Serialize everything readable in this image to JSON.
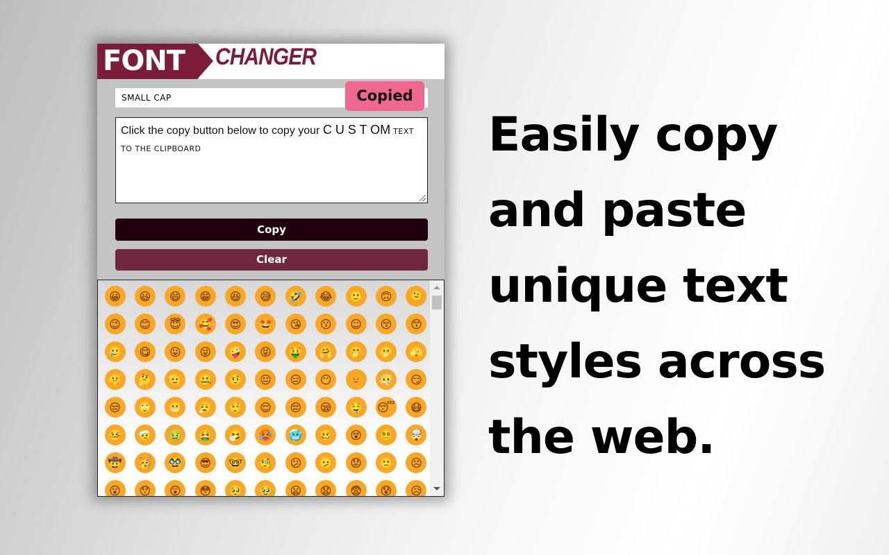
{
  "logo": {
    "part1": "FONT",
    "part2": "CHANGER",
    "brand_color": "#7a1c3a"
  },
  "style_input": {
    "value": "SMALL CAP"
  },
  "copied_badge": {
    "label": "Copied",
    "color": "#f06890"
  },
  "textarea": {
    "text_normal": "Click the copy button below to copy your ",
    "text_spaced": "C U S T OM",
    "text_smallcaps": " TEXT TO THE CLIPBOARD"
  },
  "buttons": {
    "copy": "Copy",
    "clear": "Clear"
  },
  "emojis": [
    "😀",
    "😃",
    "😄",
    "😁",
    "😆",
    "😅",
    "🤣",
    "😂",
    "🙂",
    "🙃",
    "🫠",
    "😉",
    "😊",
    "😇",
    "🥰",
    "😍",
    "🤩",
    "😘",
    "😗",
    "☺",
    "😚",
    "😙",
    "🥲",
    "😋",
    "😛",
    "😜",
    "🤪",
    "😝",
    "🤑",
    "🤗",
    "🤭",
    "🫢",
    "🫣",
    "🤫",
    "🤔",
    "🫡",
    "🤐",
    "🤨",
    "😐",
    "😑",
    "😶",
    "🫥",
    "😶‍🌫️",
    "😏",
    "😒",
    "🙄",
    "😬",
    "😮‍💨",
    "🤥",
    "😌",
    "😔",
    "😪",
    "🤤",
    "😴",
    "😷",
    "🤒",
    "🤕",
    "🤢",
    "🤮",
    "🤧",
    "🥵",
    "🥶",
    "🥴",
    "😵",
    "😵‍💫",
    "🤯",
    "🤠",
    "🥳",
    "🥸",
    "😎",
    "🤓",
    "🧐",
    "😕",
    "🫤",
    "😟",
    "🙁",
    "☹",
    "😮",
    "😯",
    "😲",
    "😳",
    "🥺",
    "🥹",
    "😦",
    "😧",
    "😨",
    "😰",
    "😥"
  ],
  "tagline": "Easily copy and paste unique text styles across the web."
}
